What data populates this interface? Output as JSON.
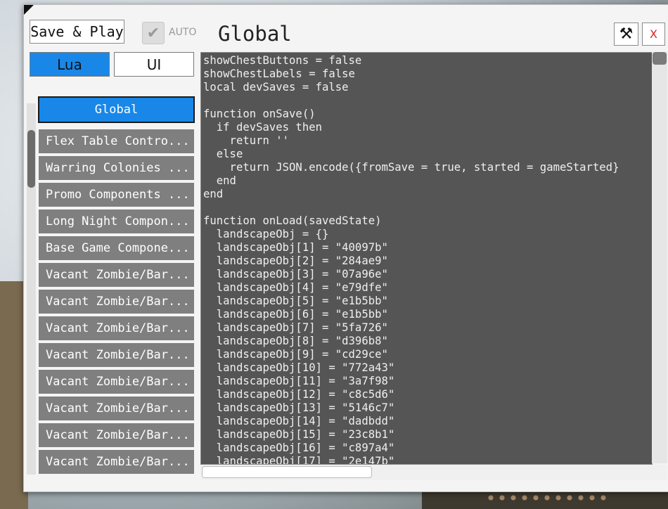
{
  "toolbar": {
    "save_play_label": "Save & Play",
    "auto_label": "AUTO",
    "auto_checked": true,
    "title": "Global",
    "tools_icon": "hammer-wrench-icon",
    "close_label": "X"
  },
  "tabs": [
    {
      "label": "Lua",
      "active": true
    },
    {
      "label": "UI",
      "active": false
    }
  ],
  "sidebar": {
    "items": [
      {
        "label": "Global",
        "selected": true
      },
      {
        "label": "Flex Table Contro...",
        "selected": false
      },
      {
        "label": "Warring Colonies ...",
        "selected": false
      },
      {
        "label": "Promo Components ...",
        "selected": false
      },
      {
        "label": "Long Night Compon...",
        "selected": false
      },
      {
        "label": "Base Game Compone...",
        "selected": false
      },
      {
        "label": "Vacant Zombie/Bar...",
        "selected": false
      },
      {
        "label": "Vacant Zombie/Bar...",
        "selected": false
      },
      {
        "label": "Vacant Zombie/Bar...",
        "selected": false
      },
      {
        "label": "Vacant Zombie/Bar...",
        "selected": false
      },
      {
        "label": "Vacant Zombie/Bar...",
        "selected": false
      },
      {
        "label": "Vacant Zombie/Bar...",
        "selected": false
      },
      {
        "label": "Vacant Zombie/Bar...",
        "selected": false
      },
      {
        "label": "Vacant Zombie/Bar...",
        "selected": false
      }
    ]
  },
  "editor": {
    "code": "showChestButtons = false\nshowChestLabels = false\nlocal devSaves = false\n\nfunction onSave()\n  if devSaves then\n    return ''\n  else\n    return JSON.encode({fromSave = true, started = gameStarted}\n  end\nend\n\nfunction onLoad(savedState)\n  landscapeObj = {}\n  landscapeObj[1] = \"40097b\"\n  landscapeObj[2] = \"284ae9\"\n  landscapeObj[3] = \"07a96e\"\n  landscapeObj[4] = \"e79dfe\"\n  landscapeObj[5] = \"e1b5bb\"\n  landscapeObj[6] = \"e1b5bb\"\n  landscapeObj[7] = \"5fa726\"\n  landscapeObj[8] = \"d396b8\"\n  landscapeObj[9] = \"cd29ce\"\n  landscapeObj[10] = \"772a43\"\n  landscapeObj[11] = \"3a7f98\"\n  landscapeObj[12] = \"c8c5d6\"\n  landscapeObj[13] = \"5146c7\"\n  landscapeObj[14] = \"dadbdd\"\n  landscapeObj[15] = \"23c8b1\"\n  landscapeObj[16] = \"c897a4\"\n  landscapeObj[17] = \"2e147b\""
  },
  "colors": {
    "accent": "#1987e8",
    "editor_bg": "#555555",
    "list_item_bg": "#7f7f7f",
    "close_red": "#dd2222"
  }
}
